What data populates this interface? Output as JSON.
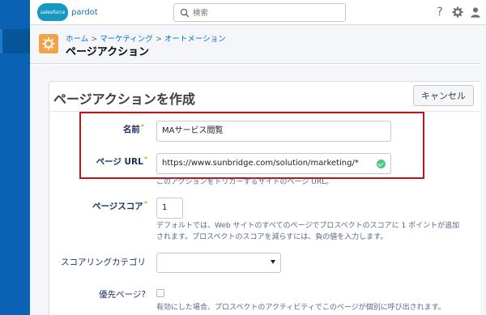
{
  "app": {
    "logo_badge": "salesforce",
    "logo_text": "pardot"
  },
  "search": {
    "placeholder": "検索",
    "value": "検索"
  },
  "header_icons": [
    "help-icon",
    "gear-icon",
    "user-icon"
  ],
  "help_glyph": "?",
  "breadcrumb": {
    "items": [
      "ホーム",
      "マーケティング",
      "オートメーション"
    ],
    "separator": ">"
  },
  "page": {
    "title": "ページアクション"
  },
  "form": {
    "title": "ページアクションを作成",
    "cancel_label": "キャンセル",
    "name_label": "名前",
    "name_value": "MAサービス閲覧",
    "url_label": "ページ URL",
    "url_value": "https://www.sunbridge.com/solution/marketing/*",
    "url_help": "このアクションをトリガーするサイトのページ URL。",
    "score_label": "ページスコア",
    "score_value": "1",
    "score_help_1": "デフォルトでは、Web サイトのすべてのページでプロスペクトのスコアに 1 ポイントが追加",
    "score_help_2": "されます。プロスペクトのスコアを減らすには、負の値を入力します。",
    "category_label": "スコアリングカテゴリ",
    "category_value": "",
    "priority_label": "優先ページ?",
    "priority_checked": false,
    "priority_help": "有効にした場合、プロスペクトのアクティビティでこのページが個別に呼び出されます。",
    "required_mark": "*"
  },
  "colors": {
    "nav": "#0b62b5",
    "accent_icon": "#f2a346",
    "highlight_box": "#c0141a",
    "link": "#0070d2"
  }
}
